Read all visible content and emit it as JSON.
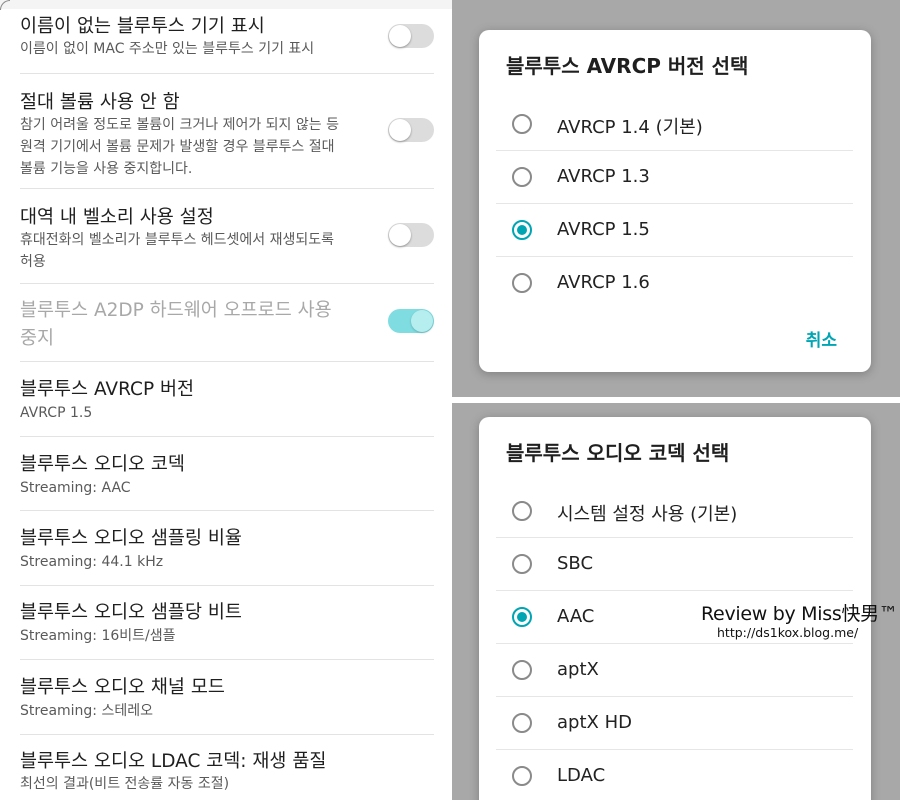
{
  "settings": {
    "items": [
      {
        "title": "이름이 없는 블루투스 기기 표시",
        "subtitle": "이름이 없이 MAC 주소만 있는 블루투스 기기 표시",
        "toggle_on": false
      },
      {
        "title": "절대 볼륨 사용 안 함",
        "subtitle_lines": [
          "참기 어려울 정도로 볼륨이 크거나 제어가 되지 않는 등",
          "원격 기기에서 볼륨 문제가 발생할 경우 블루투스 절대",
          "볼륨 기능을 사용 중지합니다."
        ],
        "toggle_on": false
      },
      {
        "title": "대역 내 벨소리 사용 설정",
        "subtitle_lines": [
          "휴대전화의 벨소리가 블루투스 헤드셋에서 재생되도록",
          "허용"
        ],
        "toggle_on": false
      },
      {
        "title_lines": [
          "블루투스 A2DP 하드웨어 오프로드 사용",
          "중지"
        ],
        "toggle_on": true,
        "disabled": true
      },
      {
        "title": "블루투스 AVRCP 버전",
        "subtitle": "AVRCP 1.5"
      },
      {
        "title": "블루투스 오디오 코덱",
        "subtitle": "Streaming: AAC"
      },
      {
        "title": "블루투스 오디오 샘플링 비율",
        "subtitle": "Streaming: 44.1 kHz"
      },
      {
        "title": "블루투스 오디오 샘플당 비트",
        "subtitle": "Streaming: 16비트/샘플"
      },
      {
        "title": "블루투스 오디오 채널 모드",
        "subtitle": "Streaming: 스테레오"
      },
      {
        "title": "블루투스 오디오 LDAC 코덱: 재생 품질",
        "subtitle": "최선의 결과(비트 전송률 자동 조절)"
      }
    ]
  },
  "avrcp_dialog": {
    "title": "블루투스 AVRCP 버전 선택",
    "options": [
      {
        "label": "AVRCP 1.4 (기본)",
        "selected": false
      },
      {
        "label": "AVRCP 1.3",
        "selected": false
      },
      {
        "label": "AVRCP 1.5",
        "selected": true
      },
      {
        "label": "AVRCP 1.6",
        "selected": false
      }
    ],
    "cancel_label": "취소"
  },
  "codec_dialog": {
    "title": "블루투스 오디오 코덱 선택",
    "options": [
      {
        "label": "시스템 설정 사용 (기본)",
        "selected": false
      },
      {
        "label": "SBC",
        "selected": false
      },
      {
        "label": "AAC",
        "selected": true
      },
      {
        "label": "aptX",
        "selected": false
      },
      {
        "label": "aptX HD",
        "selected": false
      },
      {
        "label": "LDAC",
        "selected": false
      }
    ]
  },
  "watermark": {
    "line1": "Review by Miss快男™",
    "line2": "http://ds1kox.blog.me/"
  },
  "colors": {
    "accent": "#00a5b3",
    "toggle_on": "#7fdce0",
    "toggle_off": "#dcdcdc",
    "dim_background": "#a8a8a8"
  }
}
